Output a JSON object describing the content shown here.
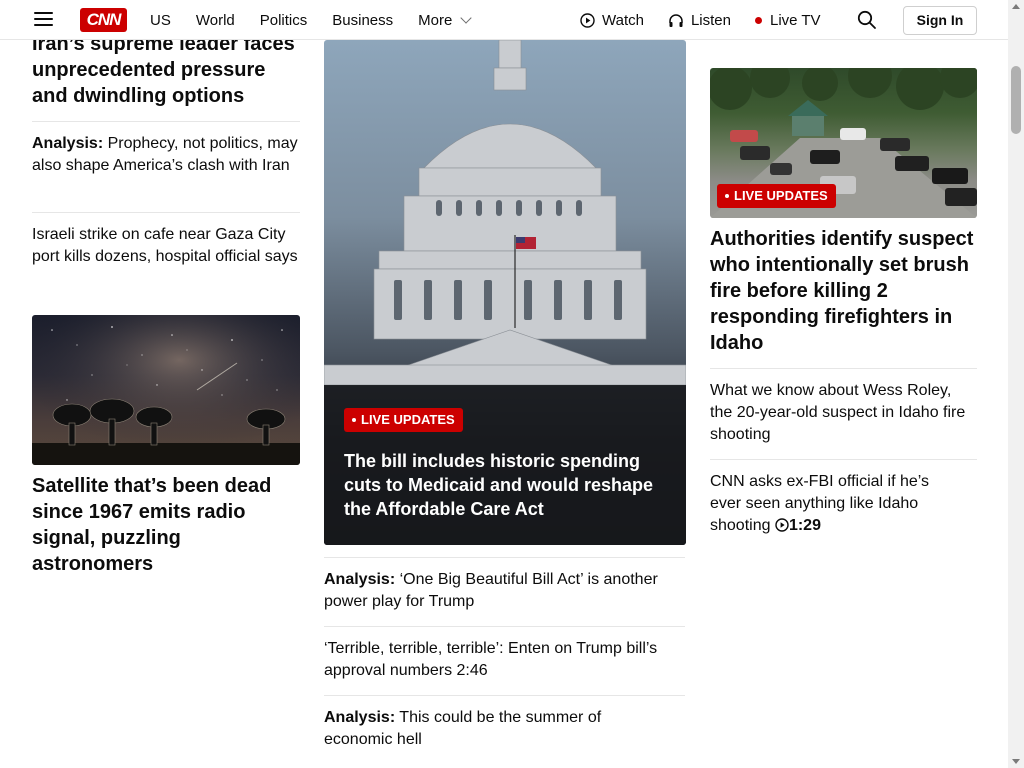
{
  "header": {
    "logo": "CNN",
    "nav": [
      "US",
      "World",
      "Politics",
      "Business",
      "More"
    ],
    "watch": "Watch",
    "listen": "Listen",
    "live_tv": "Live TV",
    "sign_in": "Sign In"
  },
  "left": {
    "top_headline": "Iran’s supreme leader faces unprecedented pressure and dwindling options",
    "story1_prefix": "Analysis:",
    "story1_text": " Prophecy, not politics, may also shape America’s clash with Iran",
    "story2": "Israeli strike on cafe near Gaza City port kills dozens, hospital official says",
    "sat_headline": "Satellite that’s been dead since 1967 emits radio signal, puzzling astronomers"
  },
  "center": {
    "badge": "LIVE UPDATES",
    "headline": "The bill includes historic spending cuts to Medicaid and would reshape the Affordable Care Act",
    "story1_prefix": "Analysis:",
    "story1_text": " ‘One Big Beautiful Bill Act’ is another power play for Trump",
    "story2": "‘Terrible, terrible, terrible’: Enten on Trump bill’s approval numbers 2:46",
    "story3_prefix": "Analysis:",
    "story3_text": " This could be the summer of economic hell"
  },
  "right": {
    "badge": "LIVE UPDATES",
    "headline": "Authorities identify suspect who intentionally set brush fire before killing 2 responding firefighters in Idaho",
    "story1": "What we know about Wess Roley, the 20-year-old suspect in Idaho fire shooting",
    "story2": "CNN asks ex-FBI official if he’s ever seen anything like Idaho shooting",
    "story2_duration": "1:29"
  },
  "colors": {
    "brand": "#cc0000",
    "text": "#0c0c0c",
    "divider": "#e6e6e6"
  }
}
